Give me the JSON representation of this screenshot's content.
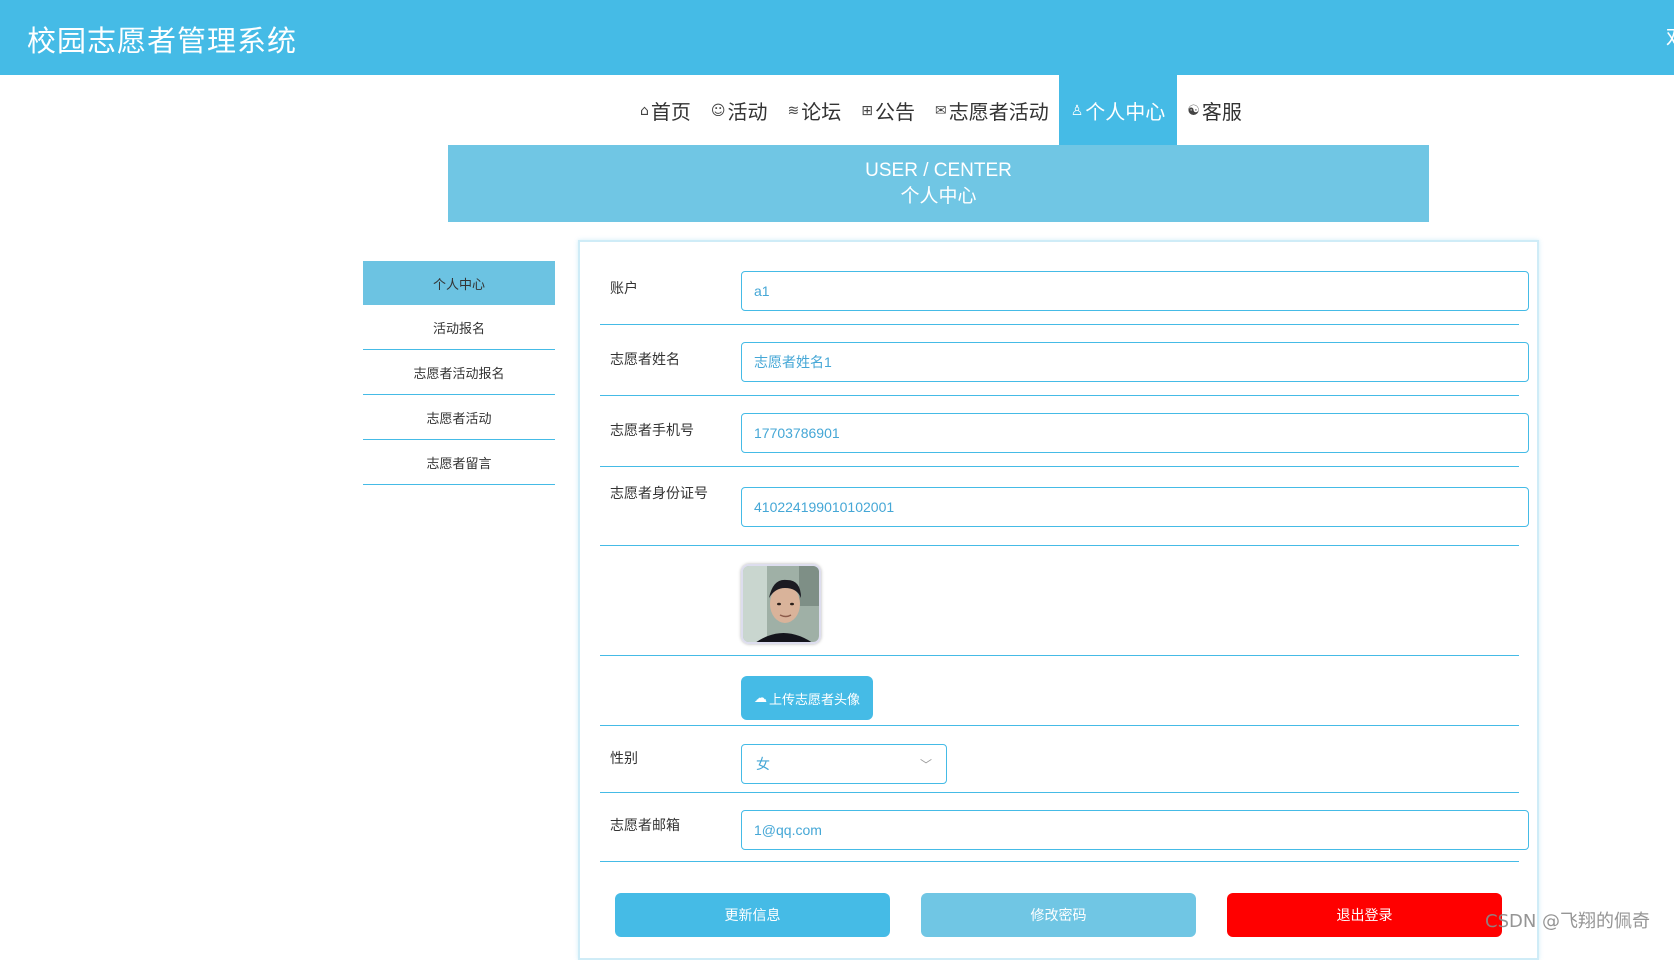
{
  "header": {
    "title": "校园志愿者管理系统",
    "corner_text": "欢"
  },
  "nav": {
    "items": [
      {
        "icon": "home-icon",
        "glyph": "⌂",
        "label": "首页"
      },
      {
        "icon": "palette-icon",
        "glyph": "☺",
        "label": "活动"
      },
      {
        "icon": "layers-icon",
        "glyph": "≋",
        "label": "论坛"
      },
      {
        "icon": "book-icon",
        "glyph": "⊞",
        "label": "公告"
      },
      {
        "icon": "mail-icon",
        "glyph": "✉",
        "label": "志愿者活动"
      },
      {
        "icon": "user-icon",
        "glyph": "♙",
        "label": "个人中心",
        "active": true
      },
      {
        "icon": "service-icon",
        "glyph": "☯",
        "label": "客服"
      }
    ]
  },
  "banner": {
    "en": "USER / CENTER",
    "cn": "个人中心"
  },
  "sidebar": {
    "items": [
      {
        "label": "个人中心",
        "active": true
      },
      {
        "label": "活动报名"
      },
      {
        "label": "志愿者活动报名"
      },
      {
        "label": "志愿者活动"
      },
      {
        "label": "志愿者留言"
      }
    ]
  },
  "form": {
    "account": {
      "label": "账户",
      "value": "a1"
    },
    "name": {
      "label": "志愿者姓名",
      "value": "志愿者姓名1"
    },
    "phone": {
      "label": "志愿者手机号",
      "value": "17703786901"
    },
    "idcard": {
      "label": "志愿者身份证号",
      "value": "410224199010102001"
    },
    "upload_label": "上传志愿者头像",
    "gender": {
      "label": "性别",
      "value": "女"
    },
    "email": {
      "label": "志愿者邮箱",
      "value": "1@qq.com"
    }
  },
  "actions": {
    "update": "更新信息",
    "change_password": "修改密码",
    "logout": "退出登录"
  },
  "watermark": "CSDN @飞翔的佩奇",
  "colors": {
    "primary": "#45bbe6",
    "light": "#70c6e4",
    "danger": "#ff0000"
  }
}
